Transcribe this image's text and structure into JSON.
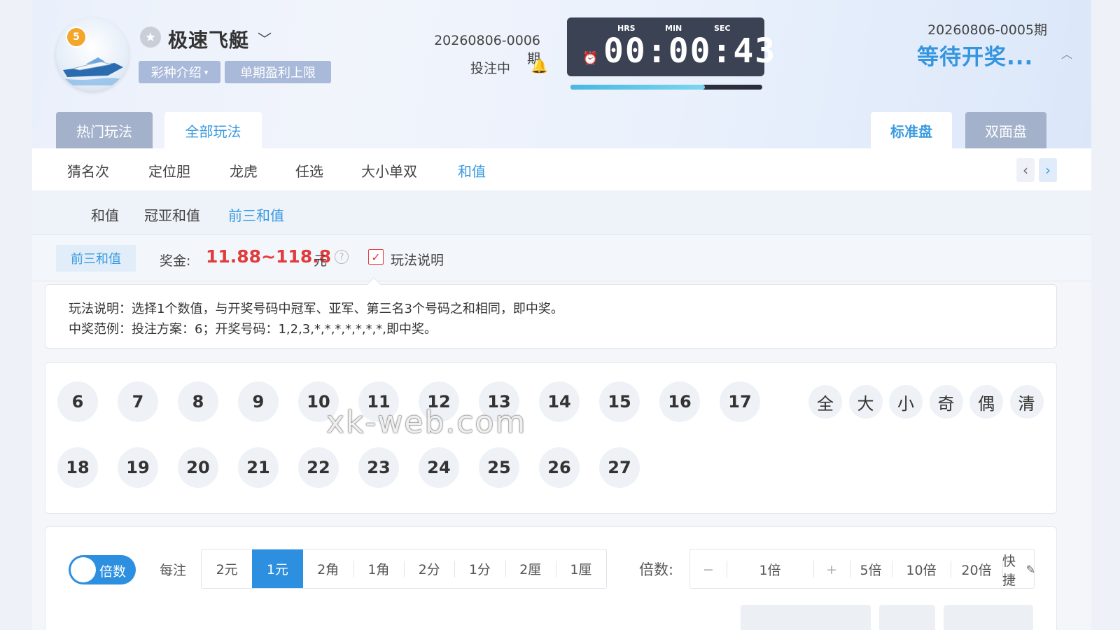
{
  "header": {
    "logo_badge": "5",
    "game_title": "极速飞艇",
    "tag_intro": "彩种介绍",
    "tag_limit": "单期盈利上限",
    "current_issue": "20260806-0006期",
    "betting_status": "投注中",
    "timer": {
      "hrs_label": "HRS",
      "min_label": "MIN",
      "sec_label": "SEC",
      "display": "00:00:43",
      "progress": 0.7
    },
    "prev_issue": "20260806-0005期",
    "waiting_text": "等待开奖..."
  },
  "tabs": {
    "hot": "热门玩法",
    "all": "全部玩法",
    "standard": "标准盘",
    "double": "双面盘"
  },
  "subnav": [
    "猜名次",
    "定位胆",
    "龙虎",
    "任选",
    "大小单双",
    "和值"
  ],
  "subsub": [
    "和值",
    "冠亚和值",
    "前三和值"
  ],
  "info": {
    "play_tag": "前三和值",
    "prize_label": "奖金:",
    "prize_value": "11.88~118.8",
    "prize_unit": "元",
    "rule_checkbox_label": "玩法说明"
  },
  "description": {
    "line1": "玩法说明：选择1个数值，与开奖号码中冠军、亚军、第三名3个号码之和相同，即中奖。",
    "line2": "中奖范例：投注方案：6；开奖号码：1,2,3,*,*,*,*,*,*,*,即中奖。"
  },
  "numbers_row1": [
    "6",
    "7",
    "8",
    "9",
    "10",
    "11",
    "12",
    "13",
    "14",
    "15",
    "16",
    "17"
  ],
  "numbers_row2": [
    "18",
    "19",
    "20",
    "21",
    "22",
    "23",
    "24",
    "25",
    "26",
    "27"
  ],
  "quick_select": [
    "全",
    "大",
    "小",
    "奇",
    "偶",
    "清"
  ],
  "watermark": "xk-web.com",
  "bet": {
    "toggle_label": "倍数",
    "per_bet_label": "每注",
    "units": [
      "2元",
      "1元",
      "2角",
      "1角",
      "2分",
      "1分",
      "2厘",
      "1厘"
    ],
    "active_unit": "1元",
    "multiplier_label": "倍数:",
    "minus": "−",
    "multiplier_value": "1倍",
    "plus": "+",
    "presets": [
      "5倍",
      "10倍",
      "20倍"
    ],
    "quick_label": "快捷"
  },
  "colors": {
    "accent": "#3a9ae0",
    "prize": "#e23b3b",
    "tab_inactive": "#a3b1cb",
    "timer_bg": "#3b4253"
  }
}
